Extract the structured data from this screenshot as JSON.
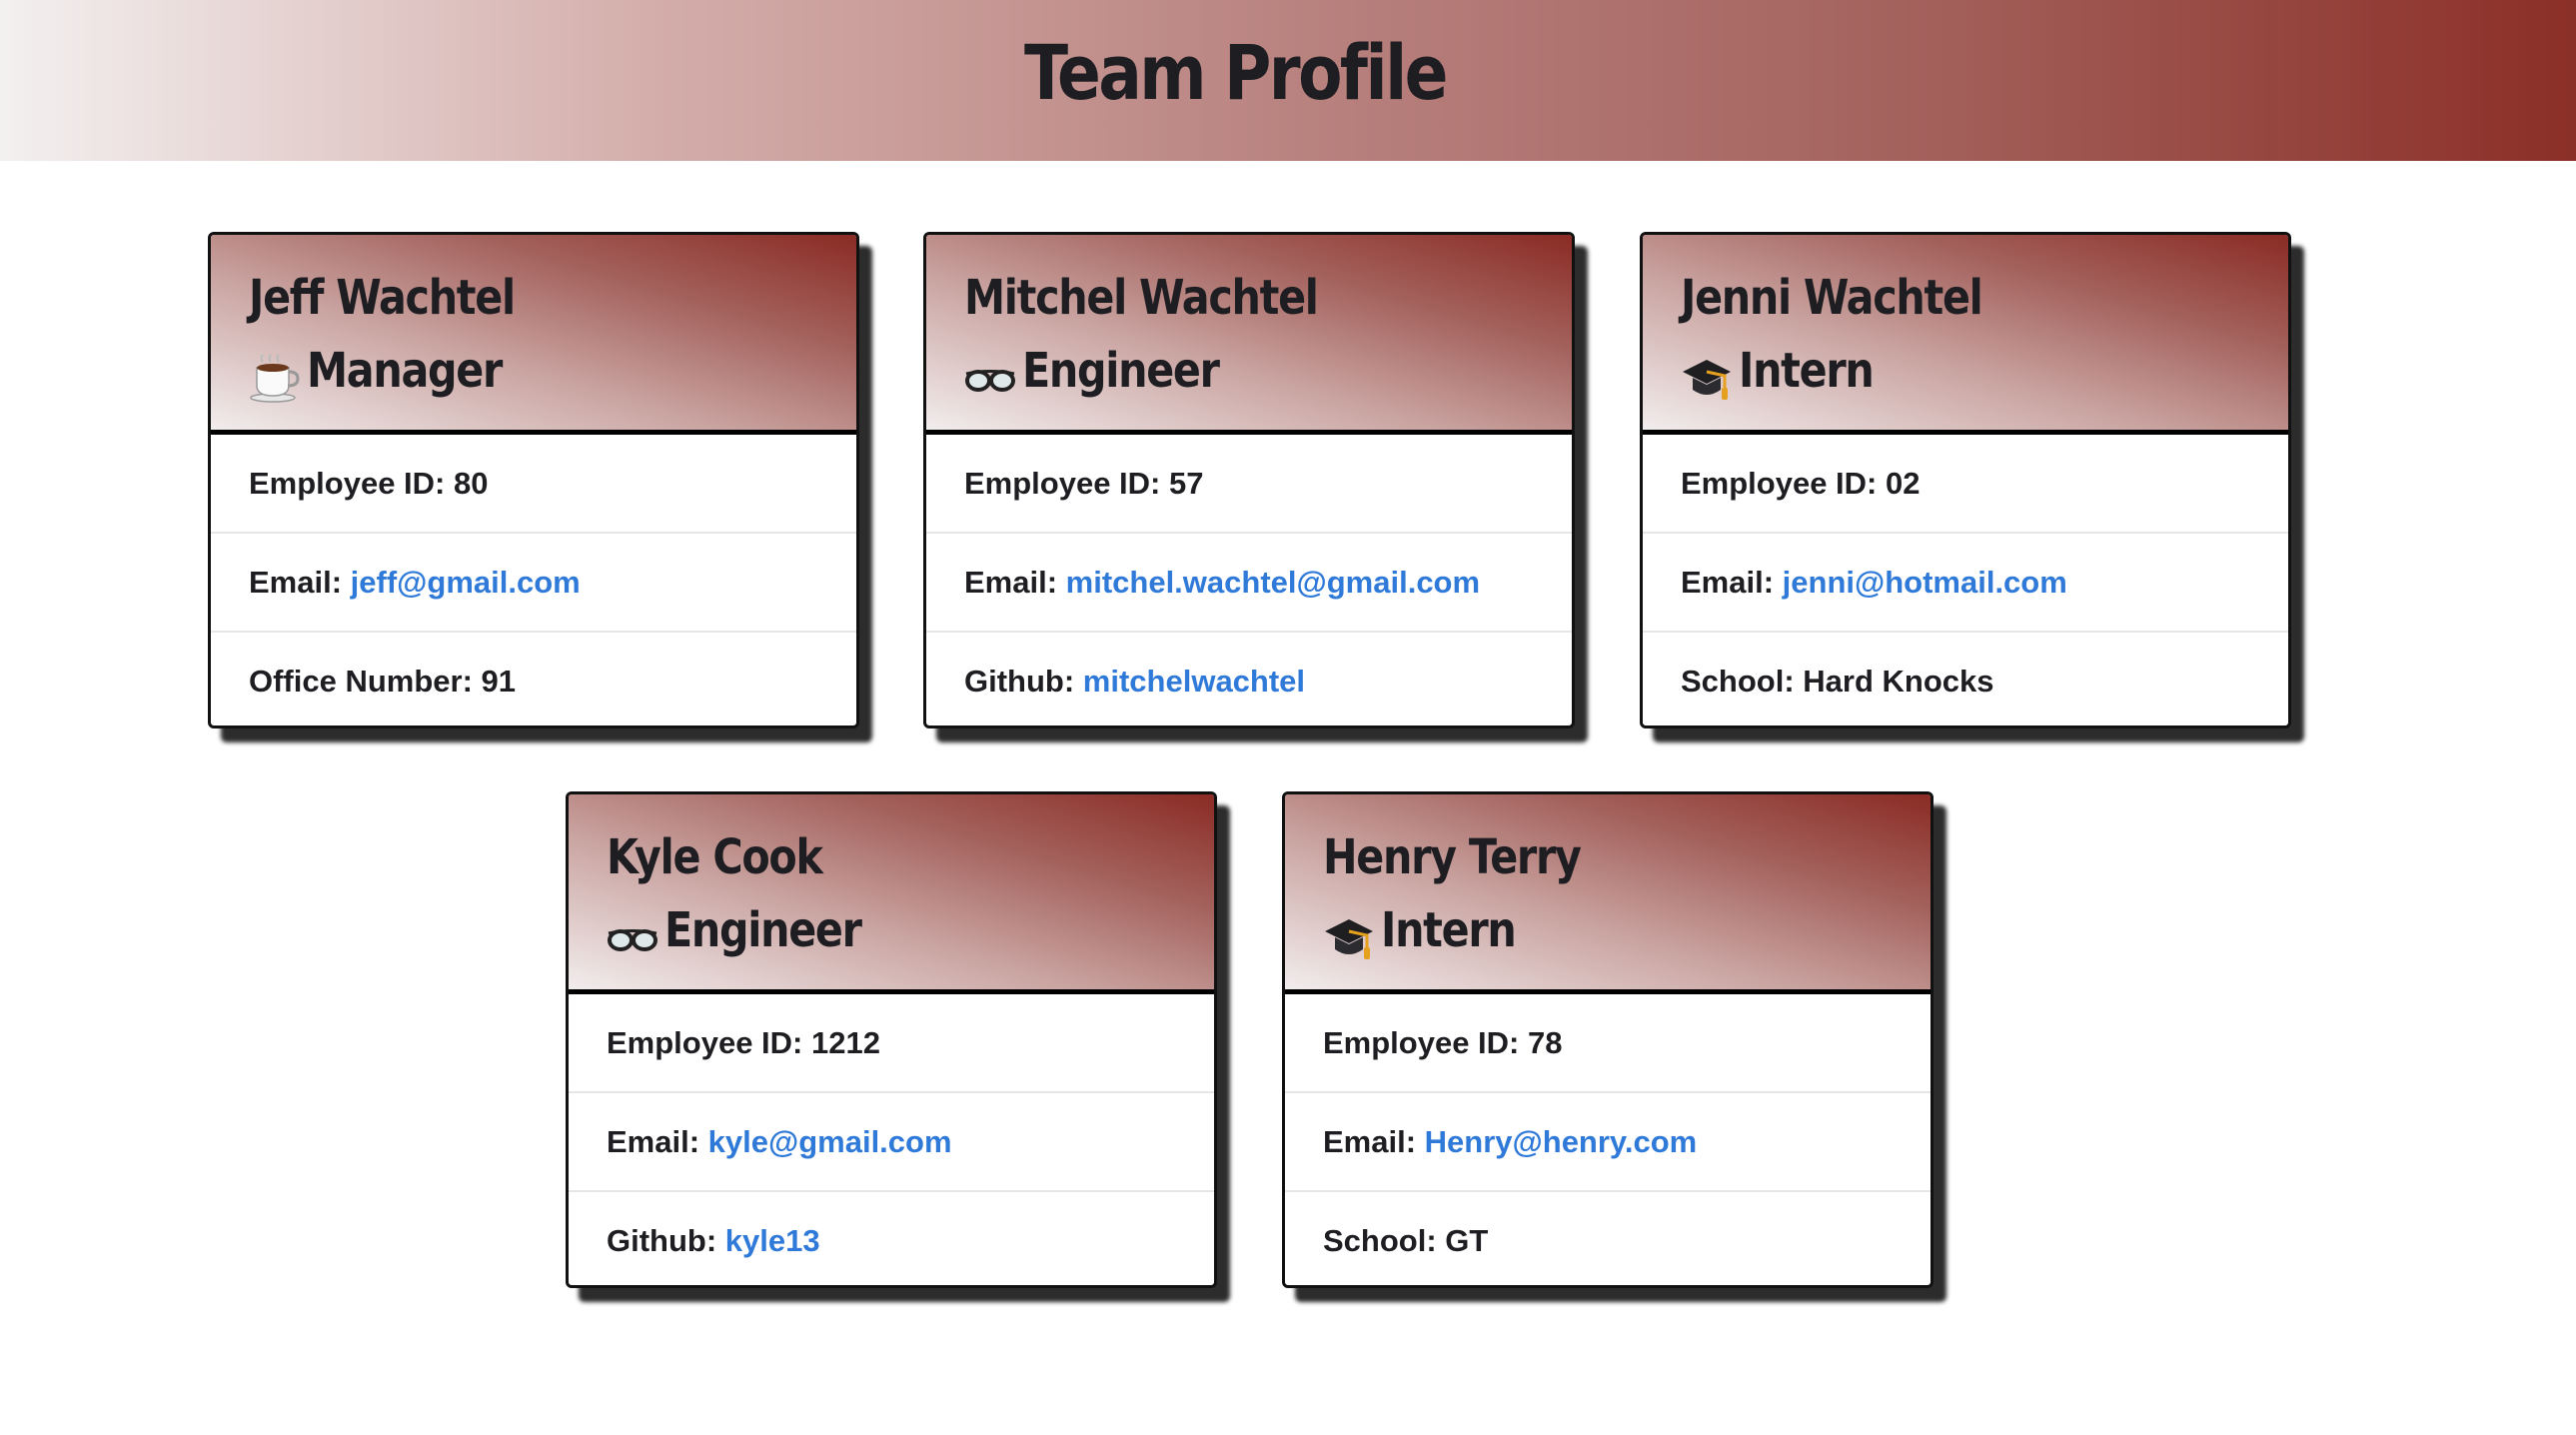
{
  "header": {
    "title": "Team Profile"
  },
  "cards": [
    {
      "name": "Jeff Wachtel",
      "role": "Manager",
      "icon": "coffee-icon",
      "id_label": "Employee ID: ",
      "id_value": "80",
      "email_label": "Email: ",
      "email_value": "jeff@gmail.com",
      "extra_label": "Office Number: ",
      "extra_value": "91"
    },
    {
      "name": "Mitchel Wachtel",
      "role": "Engineer",
      "icon": "glasses-icon",
      "id_label": "Employee ID: ",
      "id_value": "57",
      "email_label": "Email: ",
      "email_value": "mitchel.wachtel@gmail.com",
      "extra_label": "Github: ",
      "extra_value": "mitchelwachtel"
    },
    {
      "name": "Jenni Wachtel",
      "role": "Intern",
      "icon": "graduation-cap-icon",
      "id_label": "Employee ID: ",
      "id_value": "02",
      "email_label": "Email: ",
      "email_value": "jenni@hotmail.com",
      "extra_label": "School: ",
      "extra_value": "Hard Knocks"
    },
    {
      "name": "Kyle Cook",
      "role": "Engineer",
      "icon": "glasses-icon",
      "id_label": "Employee ID: ",
      "id_value": "1212",
      "email_label": "Email: ",
      "email_value": "kyle@gmail.com",
      "extra_label": "Github: ",
      "extra_value": "kyle13"
    },
    {
      "name": "Henry Terry",
      "role": "Intern",
      "icon": "graduation-cap-icon",
      "id_label": "Employee ID: ",
      "id_value": "78",
      "email_label": "Email: ",
      "email_value": "Henry@henry.com",
      "extra_label": "School: ",
      "extra_value": "GT"
    }
  ],
  "colors": {
    "header_gradient_start": "#f3f0f0",
    "header_gradient_end": "#8b2f27",
    "link": "#2f7ad9",
    "text": "#1e1e22"
  }
}
